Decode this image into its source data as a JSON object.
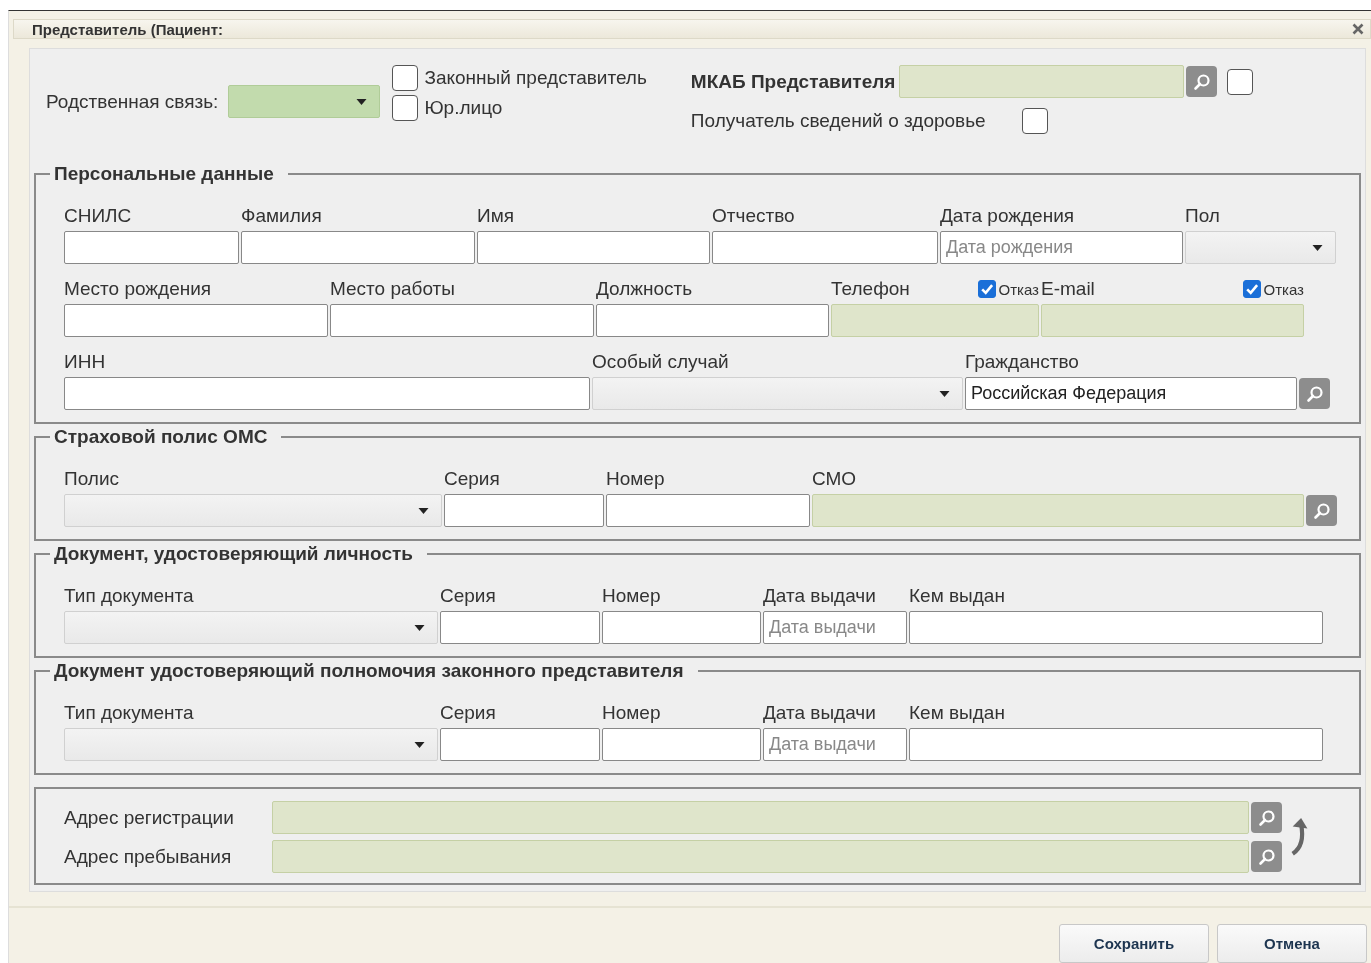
{
  "window": {
    "title": "Представитель (Пациент:"
  },
  "top": {
    "relation": {
      "label": "Родственная связь:",
      "kind": "requiredcombo"
    },
    "legal_rep": {
      "label": "Законный представитель",
      "checked": false
    },
    "legal_entity": {
      "label": "Юр.лицо",
      "checked": false
    },
    "mkab": {
      "label": "МКАБ Представителя",
      "checked": false
    },
    "health_info": {
      "label": "Получатель сведений о здоровье",
      "checked": false
    }
  },
  "sections": [
    {
      "title": "Персональные данные",
      "rows": [
        {
          "fields": [
            {
              "label": "СНИЛС",
              "kind": "text"
            },
            {
              "label": "Фамилия",
              "kind": "text"
            },
            {
              "label": "Имя",
              "kind": "text"
            },
            {
              "label": "Отчество",
              "kind": "text"
            },
            {
              "label": "Дата рождения",
              "kind": "text",
              "placeholder": "Дата рождения"
            },
            {
              "label": "Пол",
              "kind": "combo"
            }
          ]
        },
        {
          "fields": [
            {
              "label": "Место рождения",
              "kind": "text"
            },
            {
              "label": "Место работы",
              "kind": "text"
            },
            {
              "label": "Должность",
              "kind": "text"
            },
            {
              "label": "Телефон",
              "kind": "required",
              "refusal": {
                "label": "Отказ",
                "checked": true
              }
            },
            {
              "label": "E-mail",
              "kind": "required",
              "refusal": {
                "label": "Отказ",
                "checked": true
              }
            }
          ]
        },
        {
          "fields": [
            {
              "label": "ИНН",
              "kind": "text"
            },
            {
              "label": "Особый случай",
              "kind": "combo"
            },
            {
              "label": "Гражданство",
              "kind": "lookup",
              "value": "Российская Федерация"
            }
          ]
        }
      ]
    },
    {
      "title": "Страховой полис ОМС",
      "rows": [
        {
          "fields": [
            {
              "label": "Полис",
              "kind": "combo"
            },
            {
              "label": "Серия",
              "kind": "text"
            },
            {
              "label": "Номер",
              "kind": "text"
            },
            {
              "label": "СМО",
              "kind": "requiredlookup"
            }
          ]
        }
      ]
    },
    {
      "title": "Документ, удостоверяющий личность",
      "rows": [
        {
          "fields": [
            {
              "label": "Тип документа",
              "kind": "combo"
            },
            {
              "label": "Серия",
              "kind": "text"
            },
            {
              "label": "Номер",
              "kind": "text"
            },
            {
              "label": "Дата выдачи",
              "kind": "text",
              "placeholder": "Дата выдачи"
            },
            {
              "label": "Кем выдан",
              "kind": "text"
            }
          ]
        }
      ]
    },
    {
      "title": "Документ удостоверяющий полномочия законного представителя",
      "rows": [
        {
          "fields": [
            {
              "label": "Тип документа",
              "kind": "combo"
            },
            {
              "label": "Серия",
              "kind": "text"
            },
            {
              "label": "Номер",
              "kind": "text"
            },
            {
              "label": "Дата выдачи",
              "kind": "text",
              "placeholder": "Дата выдачи"
            },
            {
              "label": "Кем выдан",
              "kind": "text"
            }
          ]
        }
      ]
    }
  ],
  "addresses": [
    {
      "label": "Адрес регистрации",
      "kind": "requiredlookup"
    },
    {
      "label": "Адрес пребывания",
      "kind": "requiredlookup"
    }
  ],
  "buttons": [
    {
      "label": "Сохранить"
    },
    {
      "label": "Отмена"
    }
  ]
}
